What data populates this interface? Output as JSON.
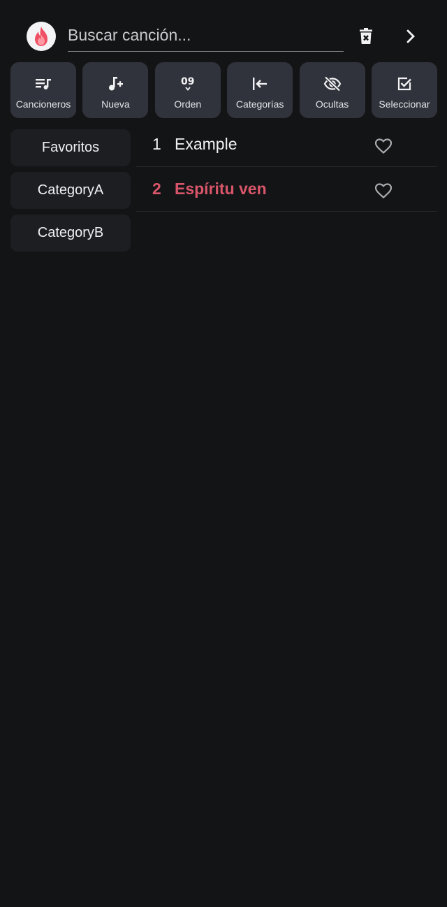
{
  "search": {
    "placeholder": "Buscar canción..."
  },
  "colors": {
    "background": "#131416",
    "accent": "#d8566a",
    "tool_bg": "#30333b",
    "category_bg": "#1d1e22"
  },
  "header": {
    "logo_icon": "flame-icon",
    "clear_icon": "delete-x-icon",
    "next_icon": "chevron-right-icon"
  },
  "toolbar": [
    {
      "label": "Cancioneros",
      "icon": "playlist-music-icon"
    },
    {
      "label": "Nueva",
      "icon": "music-note-plus-icon"
    },
    {
      "label": "Orden",
      "icon_text": "09",
      "icon": "sort-numeric-icon"
    },
    {
      "label": "Categorías",
      "icon": "arrow-to-left-icon"
    },
    {
      "label": "Ocultas",
      "icon": "eye-off-icon"
    },
    {
      "label": "Seleccionar",
      "icon": "checkbox-icon"
    }
  ],
  "categories": [
    {
      "label": "Favoritos"
    },
    {
      "label": "CategoryA"
    },
    {
      "label": "CategoryB"
    }
  ],
  "songs": [
    {
      "number": "1",
      "title": "Example",
      "active": false,
      "favorite": false
    },
    {
      "number": "2",
      "title": "Espíritu ven",
      "active": true,
      "favorite": false
    }
  ]
}
